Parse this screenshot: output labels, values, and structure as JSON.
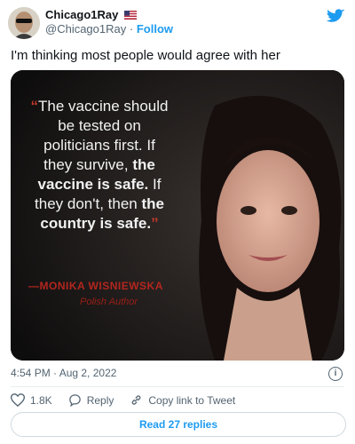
{
  "author": {
    "name": "Chicago1Ray",
    "handle": "@Chicago1Ray",
    "separator": "·",
    "follow_label": "Follow"
  },
  "tweet_text": "I'm thinking most people would agree with her",
  "media_text": {
    "quote_line1": "The vaccine should",
    "quote_line2": "be tested on",
    "quote_line3": "politicians first. If",
    "quote_line4_a": "they survive, ",
    "quote_line4_b": "the",
    "quote_line5_a": "vaccine is safe.",
    "quote_line5_b": " If",
    "quote_line6_a": "they don't, then ",
    "quote_line6_b": "the",
    "quote_line7": "country is safe.",
    "attribution": "—MONIKA WISNIEWSKA",
    "subtitle": "Polish Author"
  },
  "timestamp": "4:54 PM · Aug 2, 2022",
  "actions": {
    "likes": "1.8K",
    "reply_label": "Reply",
    "copy_label": "Copy link to Tweet"
  },
  "read_replies_label": "Read 27 replies",
  "icons": {
    "verified_flag": "us-flag-icon",
    "brand": "twitter-bird-icon",
    "info": "info-icon",
    "like": "heart-icon",
    "reply": "reply-icon",
    "copy": "link-icon"
  },
  "colors": {
    "accent": "#1d9bf0",
    "text": "#0f1419",
    "muted": "#536471",
    "quote_red": "#b3261e"
  }
}
